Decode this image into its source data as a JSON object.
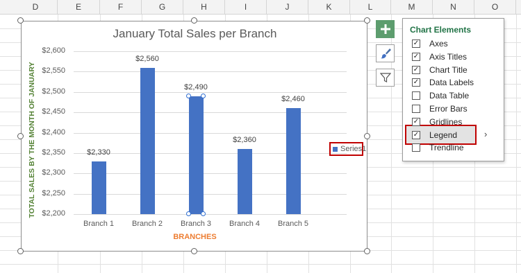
{
  "columns": [
    "D",
    "E",
    "F",
    "G",
    "H",
    "I",
    "J",
    "K",
    "L",
    "M",
    "N",
    "O"
  ],
  "chart": {
    "title": "January Total Sales per Branch",
    "ylabel": "TOTAL SALES BY THE MONTH OF JANUARY",
    "xlabel": "BRANCHES",
    "legend_label": "Series1"
  },
  "chart_data": {
    "type": "bar",
    "title": "January Total Sales per Branch",
    "xlabel": "BRANCHES",
    "ylabel": "TOTAL SALES BY THE MONTH OF JANUARY",
    "categories": [
      "Branch 1",
      "Branch 2",
      "Branch 3",
      "Branch 4",
      "Branch 5"
    ],
    "series": [
      {
        "name": "Series1",
        "values": [
          2330,
          2560,
          2490,
          2360,
          2460
        ]
      }
    ],
    "data_labels": [
      "$2,330",
      "$2,560",
      "$2,490",
      "$2,360",
      "$2,460"
    ],
    "yticks": [
      "$2,200",
      "$2,250",
      "$2,300",
      "$2,350",
      "$2,400",
      "$2,450",
      "$2,500",
      "$2,550",
      "$2,600"
    ],
    "ylim": [
      2200,
      2600
    ],
    "grid": true,
    "legend": "right",
    "bar_color": "#4472c4"
  },
  "side_buttons": {
    "elements": "chart-elements-plus-icon",
    "styles": "paintbrush-icon",
    "filters": "funnel-filter-icon"
  },
  "panel": {
    "title": "Chart Elements",
    "items": [
      {
        "label": "Axes",
        "checked": true
      },
      {
        "label": "Axis Titles",
        "checked": true
      },
      {
        "label": "Chart Title",
        "checked": true
      },
      {
        "label": "Data Labels",
        "checked": true
      },
      {
        "label": "Data Table",
        "checked": false
      },
      {
        "label": "Error Bars",
        "checked": false
      },
      {
        "label": "Gridlines",
        "checked": true
      },
      {
        "label": "Legend",
        "checked": true
      },
      {
        "label": "Trendline",
        "checked": false
      }
    ],
    "arrow": "›"
  },
  "colors": {
    "accent_green": "#217346",
    "highlight_red": "#c00000",
    "bar_blue": "#4472c4",
    "ylabel_green": "#548235",
    "xlabel_orange": "#ed7d31"
  }
}
